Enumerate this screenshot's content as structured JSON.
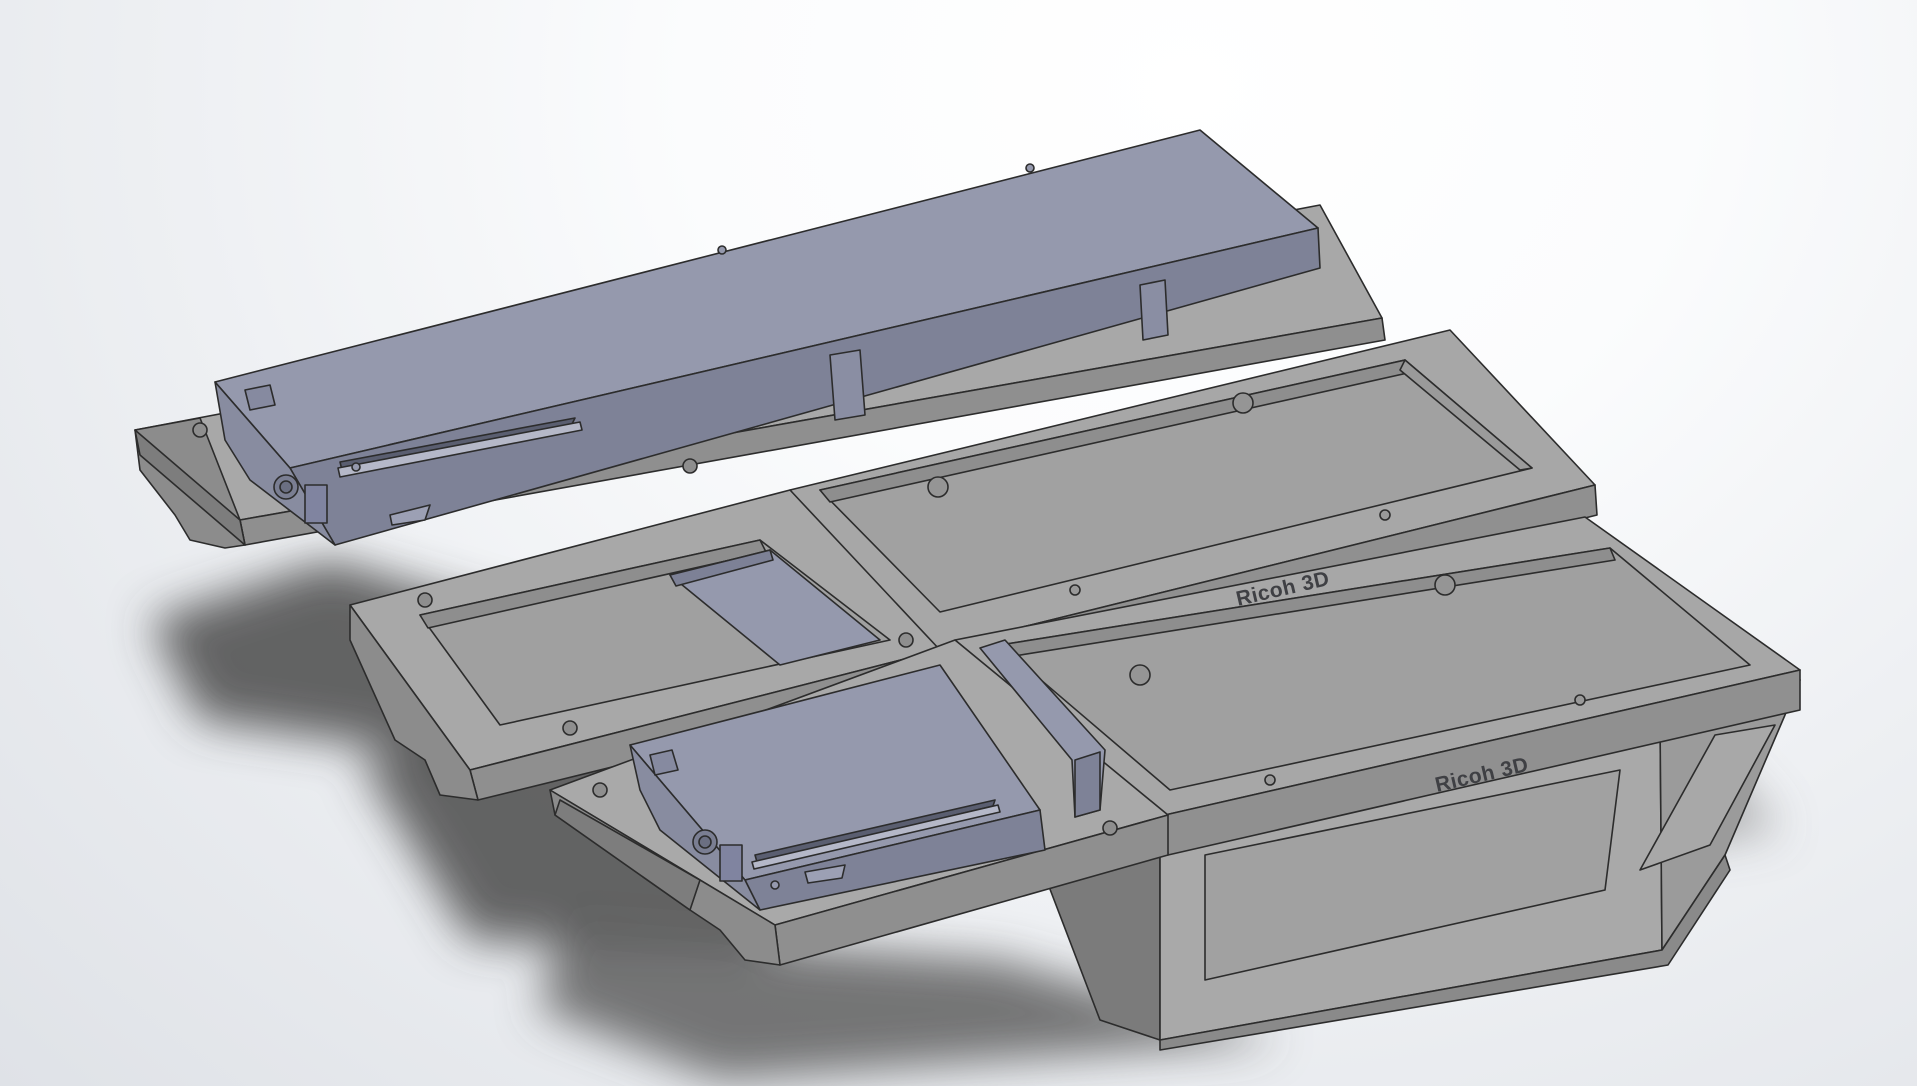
{
  "viewport": {
    "background_top": "#ffffff",
    "background_bottom": "#dfe2e7"
  },
  "model": {
    "part_color": "#a7a7a7",
    "part_dark": "#8c8c8c",
    "part_darker": "#7a7a7a",
    "component_color": "#9599ad",
    "component_dark": "#7d8196",
    "edge_color": "#2c2c2c",
    "engravings": [
      {
        "text": "Ricoh 3D"
      },
      {
        "text": "Ricoh 3D"
      }
    ]
  }
}
